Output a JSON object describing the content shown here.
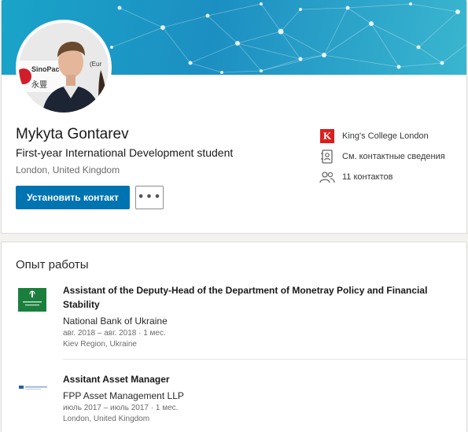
{
  "profile": {
    "name": "Mykyta Gontarev",
    "headline": "First-year International Development student",
    "location": "London, United Kingdom",
    "connect_label": "Установить контакт",
    "more_label": "•••",
    "avatar_sign_text": "SinoPac Se",
    "avatar_sign_text2": "(Eur",
    "avatar_sign_cn": "永豐",
    "side": {
      "school": "King's College London",
      "school_logo_letter": "K",
      "contact_info": "См. контактные сведения",
      "connections": "11 контактов"
    }
  },
  "experience": {
    "section_title": "Опыт работы",
    "items": [
      {
        "title": "Assistant of the Deputy-Head of the Department of Monetray Policy and Financial Stability",
        "company": "National Bank of Ukraine",
        "dates": "авг. 2018 – авг. 2018 · 1 мес.",
        "location": "Kiev Region, Ukraine",
        "logo_text": "Національний Банк України"
      },
      {
        "title": "Assitant Asset Manager",
        "company": "FPP Asset Management LLP",
        "dates": "июль 2017 – июль 2017 · 1 мес.",
        "location": "London, United Kingdom",
        "logo_text": "FPP Asset Management LLP"
      }
    ]
  },
  "colors": {
    "primary_button": "#0073b1",
    "banner": "#1c8fc2",
    "kcl_red": "#d9201f",
    "nbu_green": "#1a7f3c"
  }
}
